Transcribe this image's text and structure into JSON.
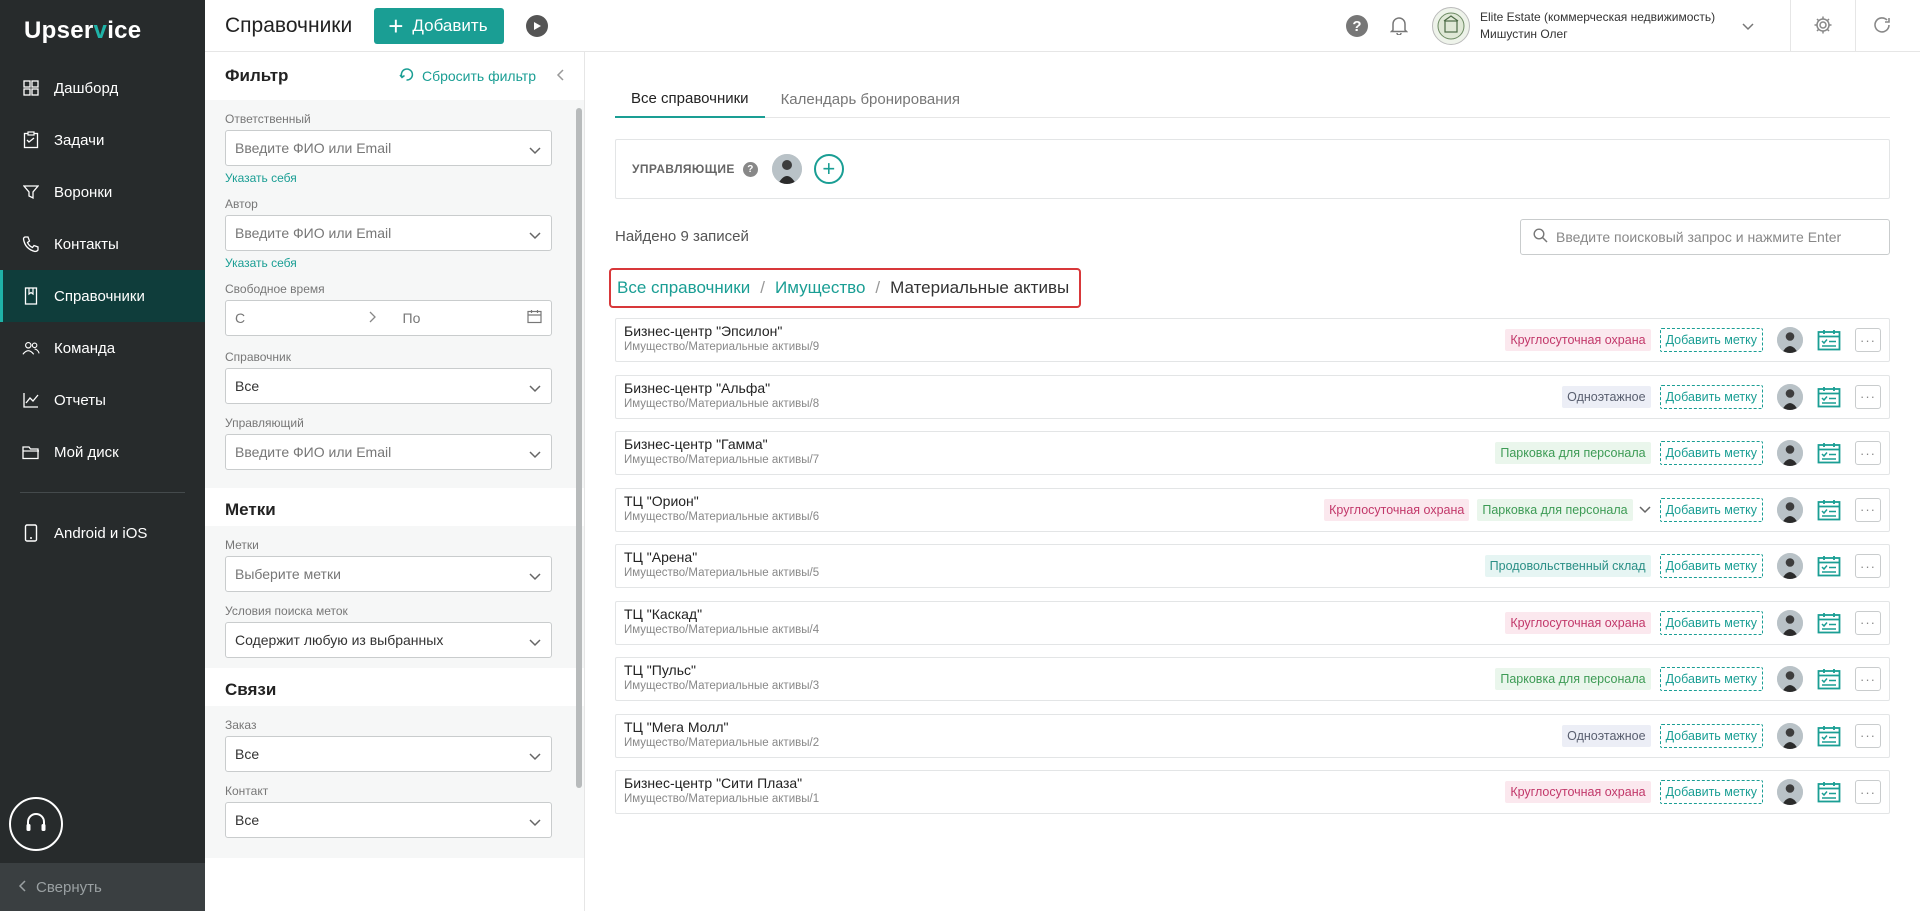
{
  "app": {
    "logo_pre": "Upser",
    "logo_v": "v",
    "logo_post": "ice"
  },
  "sidebar": {
    "items": [
      {
        "label": "Дашборд",
        "icon": "dashboard-icon"
      },
      {
        "label": "Задачи",
        "icon": "tasks-icon"
      },
      {
        "label": "Воронки",
        "icon": "funnel-icon"
      },
      {
        "label": "Контакты",
        "icon": "contacts-icon"
      },
      {
        "label": "Справочники",
        "icon": "book-icon"
      },
      {
        "label": "Команда",
        "icon": "team-icon"
      },
      {
        "label": "Отчеты",
        "icon": "chart-icon"
      },
      {
        "label": "Мой диск",
        "icon": "folder-icon"
      }
    ],
    "mobile": "Android и iOS",
    "collapse": "Свернуть"
  },
  "header": {
    "title": "Справочники",
    "add_label": "Добавить",
    "company": "Elite Estate (коммерческая недвижимость)",
    "user": "Мишустин Олег"
  },
  "filter": {
    "title": "Фильтр",
    "reset": "Сбросить фильтр",
    "responsible_label": "Ответственный",
    "responsible_placeholder": "Введите ФИО или Email",
    "self_link": "Указать себя",
    "author_label": "Автор",
    "author_placeholder": "Введите ФИО или Email",
    "free_time_label": "Свободное время",
    "from": "С",
    "to": "По",
    "directory_label": "Справочник",
    "directory_value": "Все",
    "manager_label": "Управляющий",
    "manager_placeholder": "Введите ФИО или Email",
    "tags_section": "Метки",
    "tags_label": "Метки",
    "tags_placeholder": "Выберите метки",
    "tag_cond_label": "Условия поиска меток",
    "tag_cond_value": "Содержит любую из выбранных",
    "links_section": "Связи",
    "order_label": "Заказ",
    "order_value": "Все",
    "contact_label": "Контакт",
    "contact_value": "Все"
  },
  "main": {
    "tabs": [
      "Все справочники",
      "Календарь бронирования"
    ],
    "managers_label": "УПРАВЛЯЮЩИЕ",
    "found": "Найдено 9 записей",
    "search_placeholder": "Введите поисковый запрос и нажмите Enter",
    "breadcrumb": [
      "Все справочники",
      "Имущество",
      "Материальные активы"
    ],
    "add_tag": "Добавить метку",
    "rows": [
      {
        "title": "Бизнес-центр \"Эпсилон\"",
        "path": "Имущество/Материальные активы/9",
        "tags": [
          {
            "t": "Круглосуточная охрана",
            "c": "red"
          }
        ]
      },
      {
        "title": "Бизнес-центр \"Альфа\"",
        "path": "Имущество/Материальные активы/8",
        "tags": [
          {
            "t": "Одноэтажное",
            "c": "grey"
          }
        ]
      },
      {
        "title": "Бизнес-центр \"Гамма\"",
        "path": "Имущество/Материальные активы/7",
        "tags": [
          {
            "t": "Парковка для персонала",
            "c": "green"
          }
        ]
      },
      {
        "title": "ТЦ \"Орион\"",
        "path": "Имущество/Материальные активы/6",
        "tags": [
          {
            "t": "Круглосуточная охрана",
            "c": "red"
          },
          {
            "t": "Парковка для персонала",
            "c": "green"
          }
        ],
        "more_tags": true
      },
      {
        "title": "ТЦ \"Арена\"",
        "path": "Имущество/Материальные активы/5",
        "tags": [
          {
            "t": "Продовольственный склад",
            "c": "teal"
          }
        ]
      },
      {
        "title": "ТЦ \"Каскад\"",
        "path": "Имущество/Материальные активы/4",
        "tags": [
          {
            "t": "Круглосуточная охрана",
            "c": "red"
          }
        ]
      },
      {
        "title": "ТЦ \"Пульс\"",
        "path": "Имущество/Материальные активы/3",
        "tags": [
          {
            "t": "Парковка для персонала",
            "c": "green"
          }
        ]
      },
      {
        "title": "ТЦ \"Мега Молл\"",
        "path": "Имущество/Материальные активы/2",
        "tags": [
          {
            "t": "Одноэтажное",
            "c": "grey"
          }
        ]
      },
      {
        "title": "Бизнес-центр \"Сити Плаза\"",
        "path": "Имущество/Материальные активы/1",
        "tags": [
          {
            "t": "Круглосуточная охрана",
            "c": "red"
          }
        ]
      }
    ]
  },
  "colors": {
    "accent": "#1a9e94",
    "sidebar_bg": "#272b2c",
    "sidebar_active": "#0f3d3b",
    "highlight_border": "#d8383a"
  }
}
